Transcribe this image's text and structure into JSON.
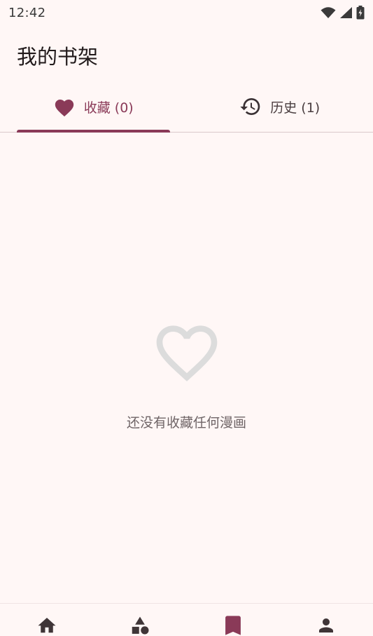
{
  "status_bar": {
    "time": "12:42",
    "icons": [
      "wifi-icon",
      "cellular-signal-icon",
      "battery-charging-icon"
    ]
  },
  "header": {
    "title": "我的书架"
  },
  "tabs": [
    {
      "label": "收藏 (0)",
      "icon": "heart-icon",
      "active": true
    },
    {
      "label": "历史 (1)",
      "icon": "history-icon",
      "active": false
    }
  ],
  "empty_state": {
    "icon": "heart-outline-icon",
    "message": "还没有收藏任何漫画"
  },
  "bottom_nav": [
    {
      "icon": "home-icon",
      "active": false
    },
    {
      "icon": "category-shapes-icon",
      "active": false
    },
    {
      "icon": "bookmark-icon",
      "active": true
    },
    {
      "icon": "person-icon",
      "active": false
    }
  ],
  "colors": {
    "background": "#fff7f6",
    "accent": "#8a3a58",
    "text": "#211a1b",
    "muted": "#6f6567",
    "empty_icon": "#dcdcdc"
  }
}
